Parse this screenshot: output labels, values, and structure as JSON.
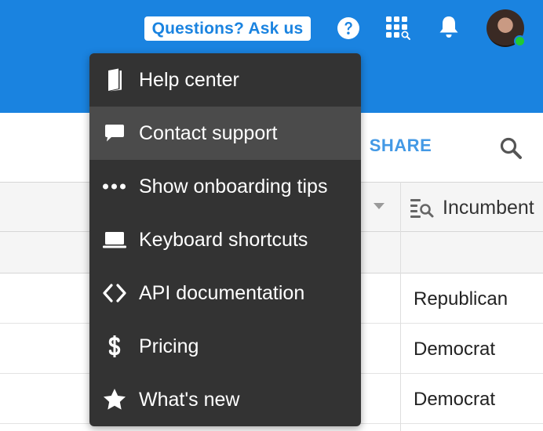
{
  "header": {
    "ask_label": "Questions? Ask us",
    "share_label": "SHARE"
  },
  "help_menu": {
    "items": [
      {
        "label": "Help center",
        "icon": "book-icon"
      },
      {
        "label": "Contact support",
        "icon": "chat-bubble-icon",
        "hovered": true
      },
      {
        "label": "Show onboarding tips",
        "icon": "ellipsis-icon"
      },
      {
        "label": "Keyboard shortcuts",
        "icon": "laptop-icon"
      },
      {
        "label": "API documentation",
        "icon": "code-brackets-icon"
      },
      {
        "label": "Pricing",
        "icon": "dollar-icon"
      },
      {
        "label": "What's new",
        "icon": "star-icon"
      }
    ]
  },
  "grid": {
    "incumbent_header": "Incumbent",
    "rows": [
      "Republican",
      "Democrat",
      "Democrat"
    ]
  },
  "colors": {
    "brand_blue": "#1a83e0",
    "menu_bg": "#333333",
    "menu_hover": "#4b4b4b",
    "online_status": "#20c933"
  }
}
